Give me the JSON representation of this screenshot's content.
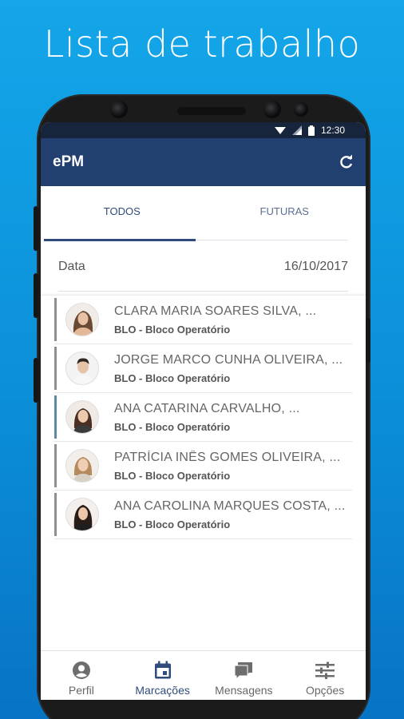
{
  "headline": "Lista de trabalho",
  "status_bar": {
    "time": "12:30",
    "icons": [
      "wifi-icon",
      "signal-icon",
      "battery-icon"
    ]
  },
  "app_bar": {
    "title": "ePM",
    "action_icon": "refresh-icon"
  },
  "tabs": [
    {
      "label": "TODOS",
      "active": true
    },
    {
      "label": "FUTURAS",
      "active": false
    }
  ],
  "filter": {
    "label": "Data",
    "value": "16/10/2017"
  },
  "worklist": [
    {
      "name": "CLARA MARIA SOARES SILVA, ...",
      "department": "BLO - Bloco Operatório"
    },
    {
      "name": "JORGE MARCO CUNHA OLIVEIRA, ...",
      "department": "BLO - Bloco Operatório"
    },
    {
      "name": "ANA CATARINA CARVALHO, ...",
      "department": "BLO - Bloco Operatório"
    },
    {
      "name": "PATRÍCIA INÊS GOMES OLIVEIRA, ...",
      "department": "BLO - Bloco Operatório"
    },
    {
      "name": "ANA CAROLINA MARQUES COSTA, ...",
      "department": "BLO - Bloco Operatório"
    }
  ],
  "bottom_nav": [
    {
      "label": "Perfil",
      "icon": "profile-icon",
      "active": false
    },
    {
      "label": "Marcações",
      "icon": "calendar-icon",
      "active": true
    },
    {
      "label": "Mensagens",
      "icon": "messages-icon",
      "active": false
    },
    {
      "label": "Opções",
      "icon": "settings-sliders-icon",
      "active": false
    }
  ],
  "colors": {
    "background": "#14a6e9",
    "app_bar": "#213f6f",
    "accent": "#2f4c7c"
  }
}
